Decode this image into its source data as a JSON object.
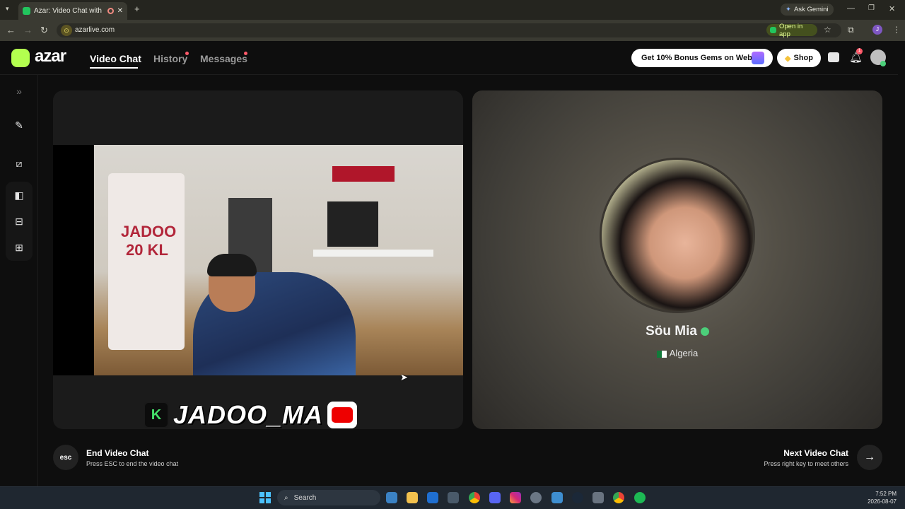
{
  "browser": {
    "tab_title": "Azar: Video Chat with New",
    "new_tab": "+",
    "ask_gemini": "Ask Gemini",
    "url": "azarlive.com",
    "open_in_app": "Open in app",
    "profile_initial": "J"
  },
  "app": {
    "logo_text": "azar",
    "nav": {
      "video_chat": "Video Chat",
      "history": "History",
      "messages": "Messages"
    },
    "bonus_label": "Get 10% Bonus Gems on Web!",
    "shop_label": "Shop",
    "notification_count": "1"
  },
  "left_video": {
    "jersey_text": "JADOO 20 KL",
    "overlay_badge": "K",
    "overlay_name": "JADOO_MA"
  },
  "partner": {
    "name": "Söu Mia",
    "country": "Algeria"
  },
  "actions": {
    "esc_key": "esc",
    "end_title": "End Video Chat",
    "end_subtitle": "Press ESC to end the video chat",
    "next_title": "Next Video Chat",
    "next_subtitle": "Press right key to meet others"
  },
  "taskbar": {
    "search_placeholder": "Search",
    "time": "7:52 PM",
    "date": "2026-08-07"
  },
  "colors": {
    "brand": "#b3ff4f",
    "notification_red": "#ff5a6a"
  }
}
